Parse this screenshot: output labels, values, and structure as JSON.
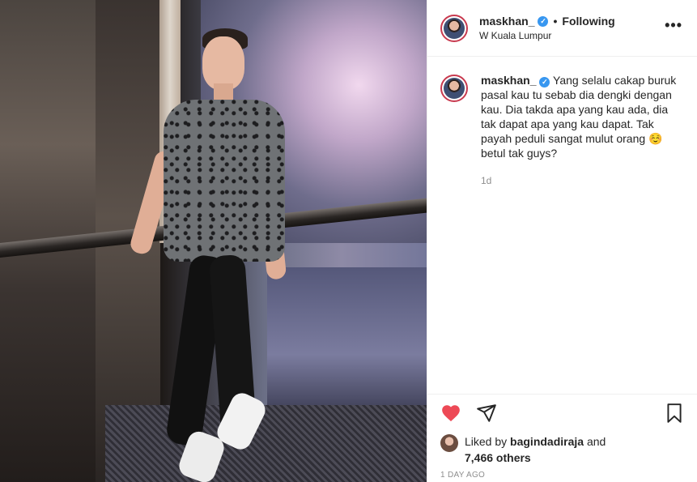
{
  "post": {
    "photo_alt": "",
    "user": {
      "username": "maskhan_",
      "verified": true,
      "follow_status": "Following",
      "separator": "•",
      "location": "W Kuala Lumpur"
    },
    "more_label": "•••",
    "caption": {
      "username": "maskhan_",
      "text": "Yang selalu cakap buruk pasal kau tu sebab dia dengki dengan kau. Dia takda apa yang kau ada, dia tak dapat apa yang kau dapat. Tak payah peduli sangat mulut orang ☺️ betul tak guys?",
      "time": "1d"
    },
    "actions": {
      "like_icon": "heart-icon",
      "share_icon": "send-icon",
      "save_icon": "bookmark-icon",
      "like_color": "#ed4956"
    },
    "likes": {
      "prefix": "Liked by",
      "user": "bagindadiraja",
      "joiner": "and",
      "others": "7,466 others"
    },
    "posted_ago": "1 DAY AGO"
  }
}
